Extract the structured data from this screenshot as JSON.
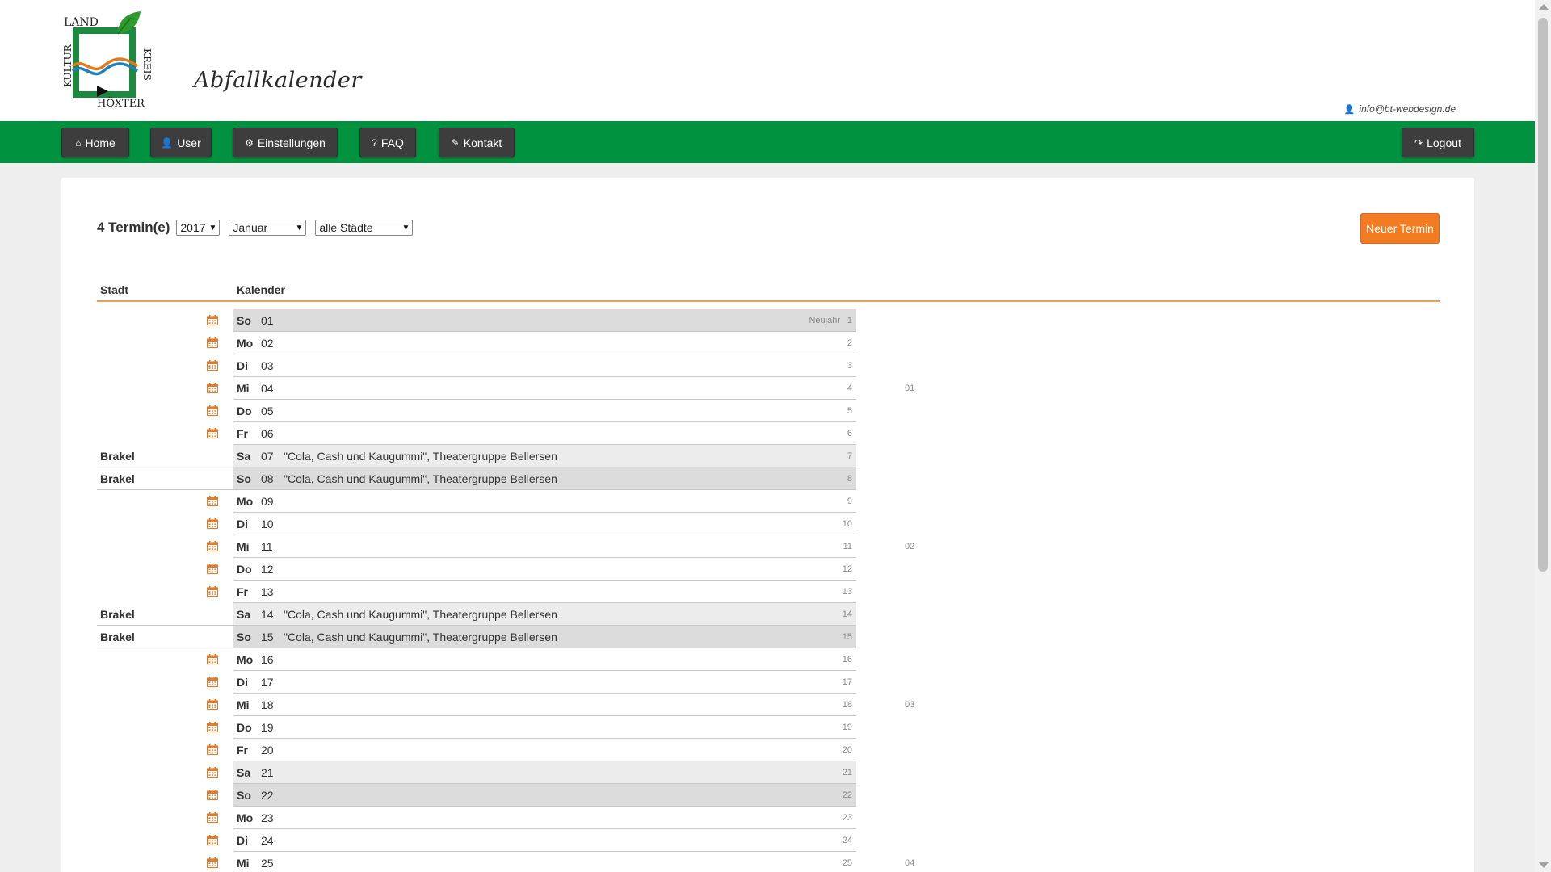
{
  "header": {
    "logo_text": [
      "LAND",
      "KULTUR",
      "KREIS",
      "HÖXTER"
    ],
    "site_title": "Abfallkalender",
    "user_email": "info@bt-webdesign.de",
    "user_icon": "user-icon",
    "brand_color": "#00923f"
  },
  "nav": {
    "items": [
      {
        "label": "Home",
        "icon": "home-icon"
      },
      {
        "label": "User",
        "icon": "user-icon"
      },
      {
        "label": "Einstellungen",
        "icon": "gear-icon"
      },
      {
        "label": "FAQ",
        "icon": "question-icon"
      },
      {
        "label": "Kontakt",
        "icon": "edit-icon"
      }
    ],
    "logout": {
      "label": "Logout",
      "icon": "sign-out-icon"
    }
  },
  "toolbar": {
    "count_label": "4 Termin(e)",
    "year": "2017",
    "month": "Januar",
    "city_filter": "alle Städte",
    "new_button": "Neuer Termin",
    "accent_color": "#f37c22"
  },
  "table": {
    "headers": {
      "city": "Stadt",
      "calendar": "Kalender"
    },
    "rows": [
      {
        "city": "",
        "weekday": "So",
        "day": "01",
        "event": "",
        "holiday": "Neujahr",
        "doy": "1",
        "kw": ""
      },
      {
        "city": "",
        "weekday": "Mo",
        "day": "02",
        "event": "",
        "holiday": "",
        "doy": "2",
        "kw": ""
      },
      {
        "city": "",
        "weekday": "Di",
        "day": "03",
        "event": "",
        "holiday": "",
        "doy": "3",
        "kw": ""
      },
      {
        "city": "",
        "weekday": "Mi",
        "day": "04",
        "event": "",
        "holiday": "",
        "doy": "4",
        "kw": "01"
      },
      {
        "city": "",
        "weekday": "Do",
        "day": "05",
        "event": "",
        "holiday": "",
        "doy": "5",
        "kw": ""
      },
      {
        "city": "",
        "weekday": "Fr",
        "day": "06",
        "event": "",
        "holiday": "",
        "doy": "6",
        "kw": ""
      },
      {
        "city": "Brakel",
        "weekday": "Sa",
        "day": "07",
        "event": "\"Cola, Cash und Kaugummi\", Theatergruppe Bellersen",
        "holiday": "",
        "doy": "7",
        "kw": ""
      },
      {
        "city": "Brakel",
        "weekday": "So",
        "day": "08",
        "event": "\"Cola, Cash und Kaugummi\", Theatergruppe Bellersen",
        "holiday": "",
        "doy": "8",
        "kw": ""
      },
      {
        "city": "",
        "weekday": "Mo",
        "day": "09",
        "event": "",
        "holiday": "",
        "doy": "9",
        "kw": ""
      },
      {
        "city": "",
        "weekday": "Di",
        "day": "10",
        "event": "",
        "holiday": "",
        "doy": "10",
        "kw": ""
      },
      {
        "city": "",
        "weekday": "Mi",
        "day": "11",
        "event": "",
        "holiday": "",
        "doy": "11",
        "kw": "02"
      },
      {
        "city": "",
        "weekday": "Do",
        "day": "12",
        "event": "",
        "holiday": "",
        "doy": "12",
        "kw": ""
      },
      {
        "city": "",
        "weekday": "Fr",
        "day": "13",
        "event": "",
        "holiday": "",
        "doy": "13",
        "kw": ""
      },
      {
        "city": "Brakel",
        "weekday": "Sa",
        "day": "14",
        "event": "\"Cola, Cash und Kaugummi\", Theatergruppe Bellersen",
        "holiday": "",
        "doy": "14",
        "kw": ""
      },
      {
        "city": "Brakel",
        "weekday": "So",
        "day": "15",
        "event": "\"Cola, Cash und Kaugummi\", Theatergruppe Bellersen",
        "holiday": "",
        "doy": "15",
        "kw": ""
      },
      {
        "city": "",
        "weekday": "Mo",
        "day": "16",
        "event": "",
        "holiday": "",
        "doy": "16",
        "kw": ""
      },
      {
        "city": "",
        "weekday": "Di",
        "day": "17",
        "event": "",
        "holiday": "",
        "doy": "17",
        "kw": ""
      },
      {
        "city": "",
        "weekday": "Mi",
        "day": "18",
        "event": "",
        "holiday": "",
        "doy": "18",
        "kw": "03"
      },
      {
        "city": "",
        "weekday": "Do",
        "day": "19",
        "event": "",
        "holiday": "",
        "doy": "19",
        "kw": ""
      },
      {
        "city": "",
        "weekday": "Fr",
        "day": "20",
        "event": "",
        "holiday": "",
        "doy": "20",
        "kw": ""
      },
      {
        "city": "",
        "weekday": "Sa",
        "day": "21",
        "event": "",
        "holiday": "",
        "doy": "21",
        "kw": ""
      },
      {
        "city": "",
        "weekday": "So",
        "day": "22",
        "event": "",
        "holiday": "",
        "doy": "22",
        "kw": ""
      },
      {
        "city": "",
        "weekday": "Mo",
        "day": "23",
        "event": "",
        "holiday": "",
        "doy": "23",
        "kw": ""
      },
      {
        "city": "",
        "weekday": "Di",
        "day": "24",
        "event": "",
        "holiday": "",
        "doy": "24",
        "kw": ""
      },
      {
        "city": "",
        "weekday": "Mi",
        "day": "25",
        "event": "",
        "holiday": "",
        "doy": "25",
        "kw": "04"
      }
    ]
  }
}
